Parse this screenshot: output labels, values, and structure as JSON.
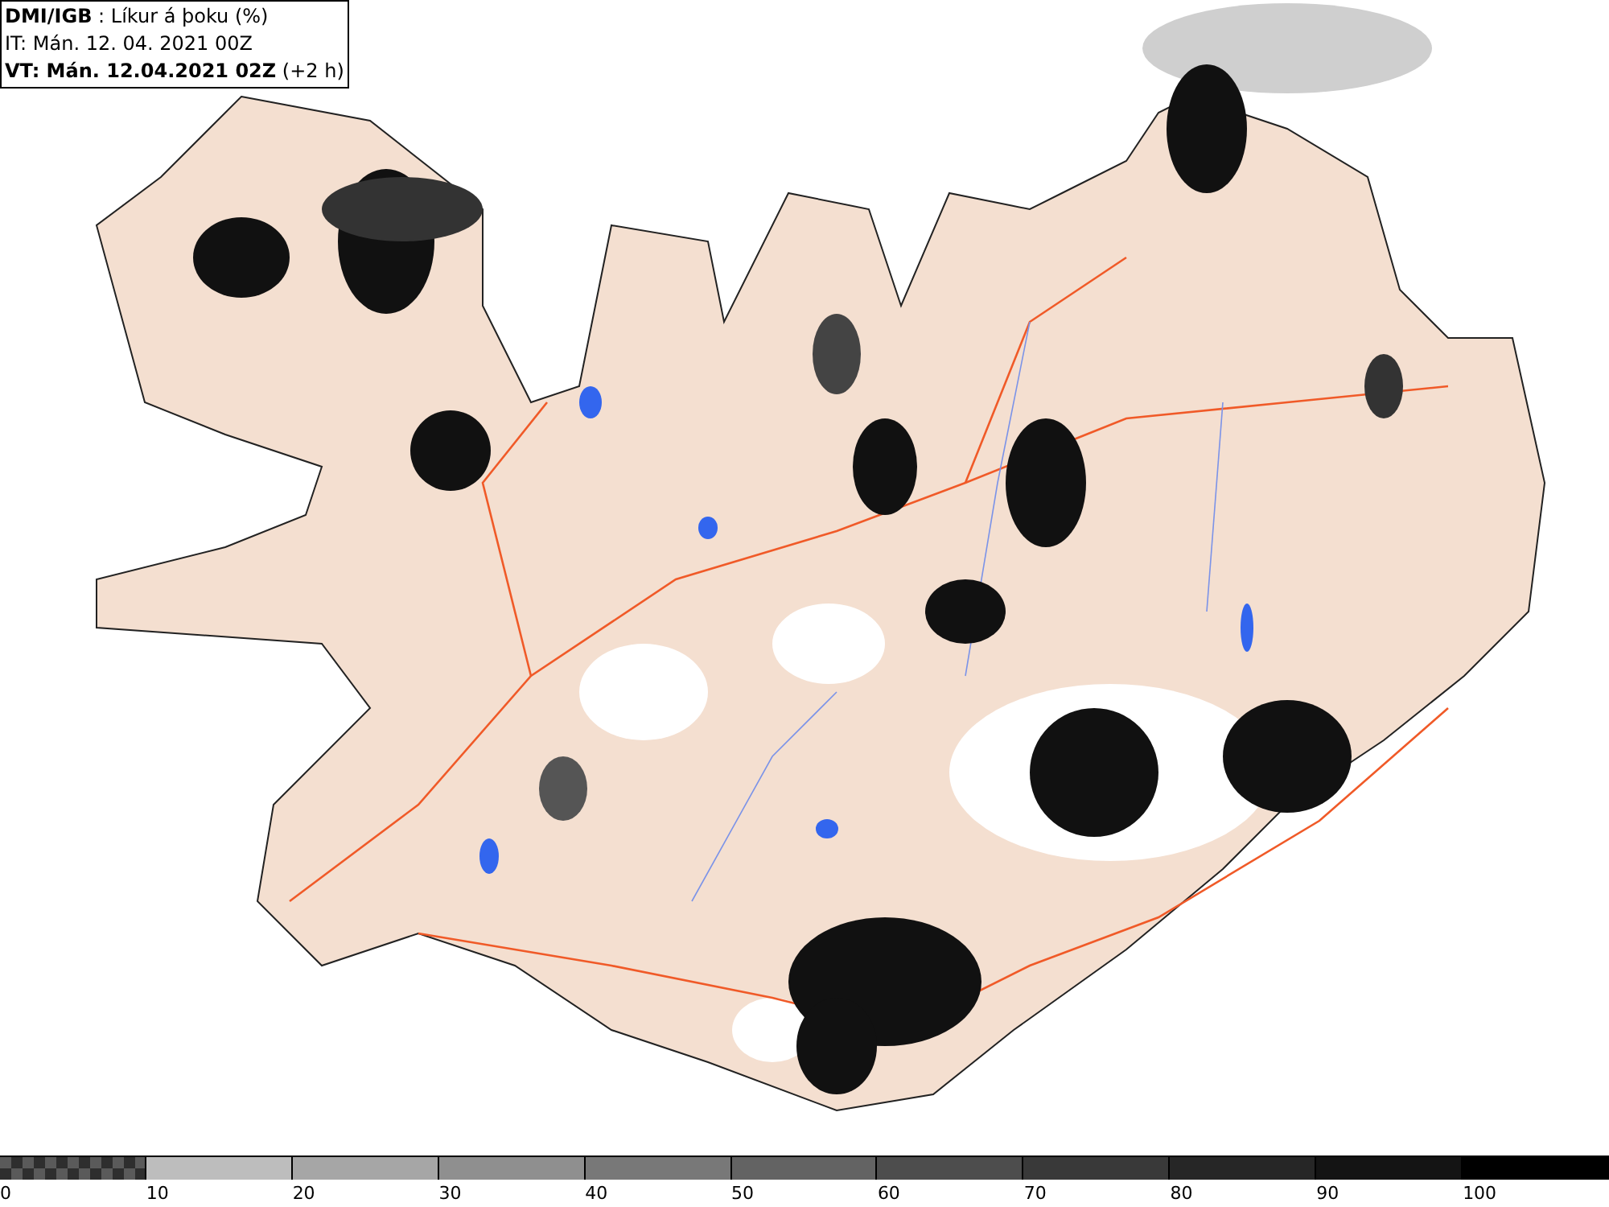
{
  "header": {
    "title": "**DMI/IGB** : Líkur á þoku (%)",
    "issue_time": "IT: Mán. 12. 04. 2021 00Z",
    "valid_time": "**VT: Mán. 12.04.2021 02Z** (+2 h)"
  },
  "legend": {
    "segments": [
      {
        "kind": "checker",
        "color": "#5a5a5a"
      },
      {
        "kind": "solid",
        "color": "#bdbdbd"
      },
      {
        "kind": "solid",
        "color": "#a6a6a6"
      },
      {
        "kind": "solid",
        "color": "#8f8f8f"
      },
      {
        "kind": "solid",
        "color": "#787878"
      },
      {
        "kind": "solid",
        "color": "#636363"
      },
      {
        "kind": "solid",
        "color": "#4d4d4d"
      },
      {
        "kind": "solid",
        "color": "#393939"
      },
      {
        "kind": "solid",
        "color": "#262626"
      },
      {
        "kind": "solid",
        "color": "#141414"
      },
      {
        "kind": "solid",
        "color": "#000000"
      }
    ],
    "labels": [
      "0",
      "10",
      "20",
      "30",
      "40",
      "50",
      "60",
      "70",
      "80",
      "90",
      "100"
    ]
  }
}
